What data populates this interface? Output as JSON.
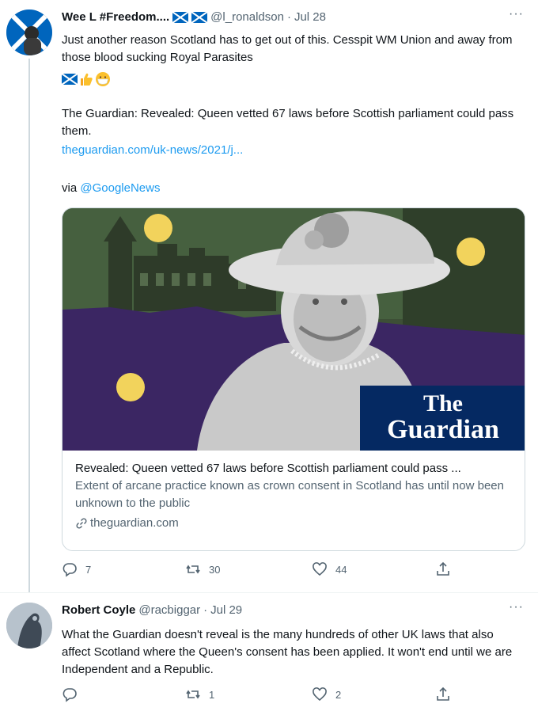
{
  "tweets": [
    {
      "display_name": "Wee L #Freedom....",
      "handle": "@l_ronaldson",
      "separator": "·",
      "time": "Jul 28",
      "text": "Just another reason Scotland has to get out of this. Cesspit WM Union and away from those blood sucking Royal Parasites",
      "quote_line": "The Guardian: Revealed: Queen vetted 67 laws before Scottish parliament could pass them.",
      "link": "theguardian.com/uk-news/2021/j...",
      "via_prefix": "via",
      "via_handle": "@GoogleNews",
      "card": {
        "title": "Revealed: Queen vetted 67 laws before Scottish parliament could pass ...",
        "description": "Extent of arcane practice known as crown consent in Scotland has until now been unknown to the public",
        "domain": "theguardian.com",
        "logo_line1": "The",
        "logo_line2": "Guardian"
      },
      "actions": {
        "replies": "7",
        "retweets": "30",
        "likes": "44"
      }
    },
    {
      "display_name": "Robert Coyle",
      "handle": "@racbiggar",
      "separator": "·",
      "time": "Jul 29",
      "text": "What the Guardian doesn't reveal is the many hundreds of other UK laws that also affect Scotland where the Queen's consent has been applied. It won't end until we are Independent and a Republic.",
      "actions": {
        "replies": "",
        "retweets": "1",
        "likes": "2"
      }
    }
  ],
  "more_label": "···",
  "icons": [
    "reply-icon",
    "retweet-icon",
    "like-icon",
    "share-icon",
    "link-icon",
    "scottish-flag-icon",
    "thumbs-up-emoji",
    "mask-face-emoji"
  ],
  "colors": {
    "link": "#1d9bf0",
    "secondary_text": "#536471",
    "border": "#cfd9de",
    "guardian_blue": "#052962",
    "scotland_blue": "#0065bd"
  }
}
